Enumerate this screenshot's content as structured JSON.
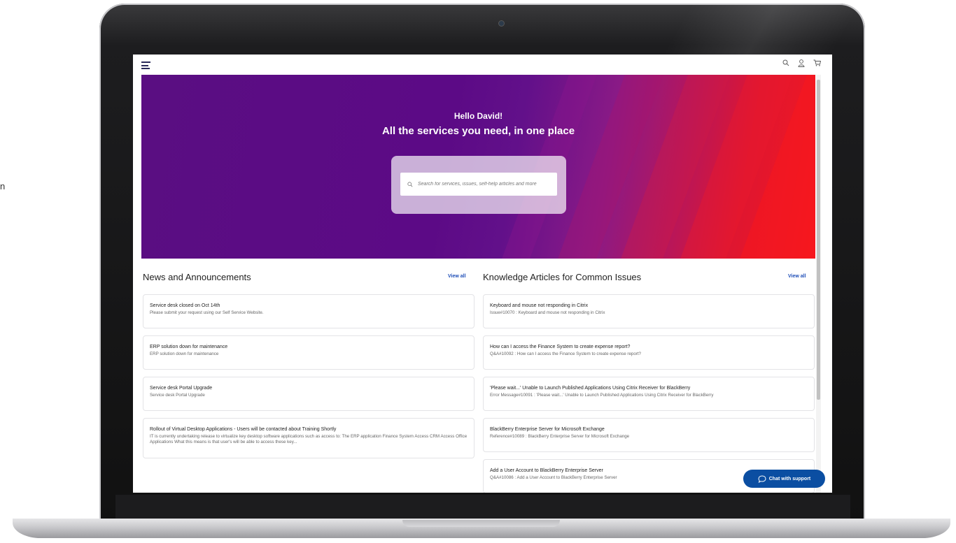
{
  "stray_text": "n",
  "header": {
    "icons": [
      "menu-icon",
      "search-icon",
      "user-icon",
      "cart-icon"
    ]
  },
  "hero": {
    "greeting": "Hello David!",
    "title": "All the services you need, in one place",
    "search_placeholder": "Search for services, issues, self-help articles and more"
  },
  "news": {
    "title": "News and Announcements",
    "view_all": "View all",
    "items": [
      {
        "title": "Service desk closed on Oct 14th",
        "desc": "Please submit your request using our Self Service Website."
      },
      {
        "title": "ERP solution down for maintenance",
        "desc": "ERP solution down for maintenance"
      },
      {
        "title": "Service desk Portal Upgrade",
        "desc": "Service desk Portal Upgrade"
      },
      {
        "title": "Rollout of Virtual Desktop Applications - Users will be contacted about Training Shortly",
        "desc": "IT is currently undertaking release to virtualize key desktop software applications such as access to: The ERP application Finance System Access CRM Access Office Applications What this means is that user's will be able to access these key..."
      }
    ]
  },
  "knowledge": {
    "title": "Knowledge Articles for Common Issues",
    "view_all": "View all",
    "items": [
      {
        "title": "Keyboard and mouse not responding in Citrix",
        "desc": "Issue#10070 : Keyboard and mouse not responding in Citrix"
      },
      {
        "title": "How can I access the Finance System to create expense report?",
        "desc": "Q&A#10092 : How can I access the Finance System to create expense report?"
      },
      {
        "title": "'Please wait...' Unable to Launch Published Applications Using Citrix Receiver for BlackBerry",
        "desc": "Error Message#10091 : 'Please wait...' Unable to Launch Published Applications Using Citrix Receiver for BlackBerry"
      },
      {
        "title": "BlackBerry Enterprise Server for Microsoft Exchange",
        "desc": "Reference#10089 : BlackBerry Enterprise Server for Microsoft Exchange"
      },
      {
        "title": "Add a User Account to BlackBerry Enterprise Server",
        "desc": "Q&A#10086 : Add a User Account to BlackBerry Enterprise Server"
      }
    ]
  },
  "chat": {
    "label": "Chat with support"
  },
  "colors": {
    "hero_start": "#5a0e82",
    "hero_end": "#f5181f",
    "link": "#1f4fb8",
    "chat_button": "#0b4ea2"
  }
}
